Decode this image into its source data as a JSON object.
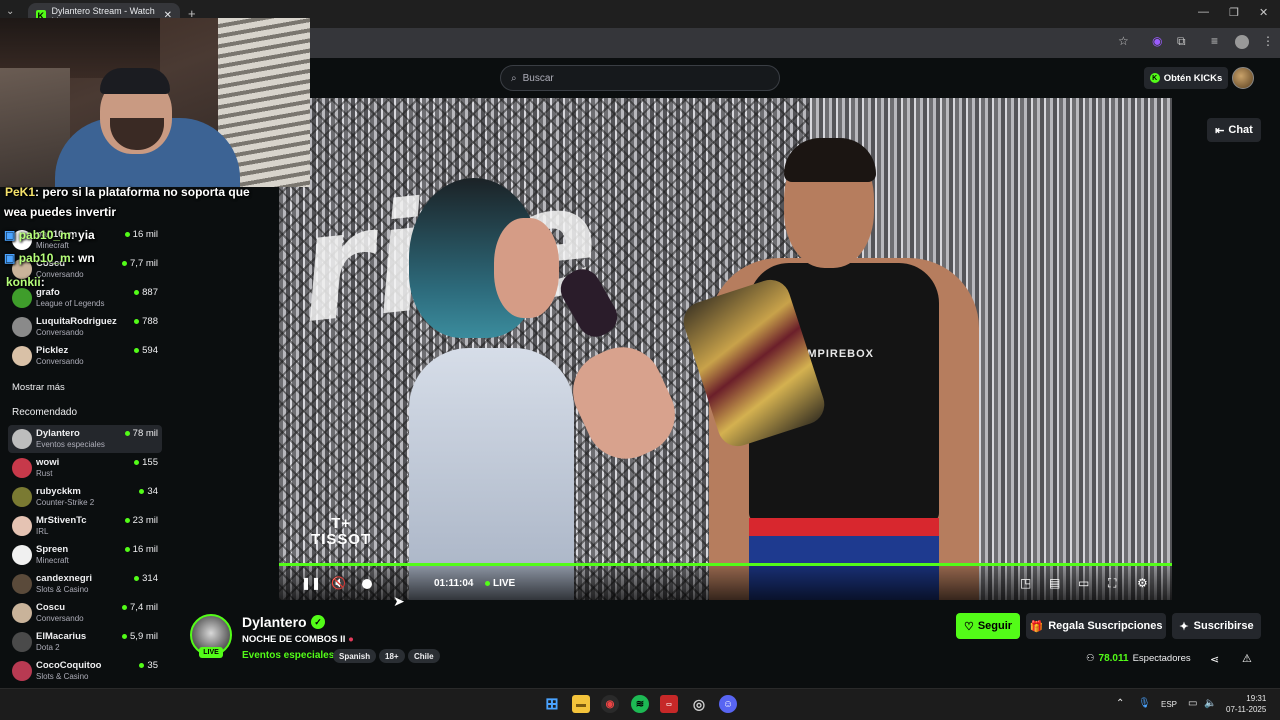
{
  "browser": {
    "tab_title": "Dylantero Stream - Watch Live",
    "tab_close": "✕",
    "new_tab": "+",
    "window_controls": [
      "—",
      "❐",
      "✕"
    ]
  },
  "header": {
    "search_placeholder": "Buscar",
    "kicks_button": "Obtén KICKs"
  },
  "sidebar": {
    "following": [
      {
        "name": "pab10_m",
        "category": "Minecraft",
        "viewers": "16 mil"
      },
      {
        "name": "Coscu",
        "category": "Conversando",
        "viewers": "7,7 mil"
      },
      {
        "name": "grafo",
        "category": "League of Legends",
        "viewers": "887"
      },
      {
        "name": "LuquitaRodriguez",
        "category": "Conversando",
        "viewers": "788"
      },
      {
        "name": "Picklez",
        "category": "Conversando",
        "viewers": "594"
      }
    ],
    "show_more": "Mostrar más",
    "recommended_label": "Recomendado",
    "recommended": [
      {
        "name": "Dylantero",
        "category": "Eventos especiales",
        "viewers": "78 mil"
      },
      {
        "name": "wowi",
        "category": "Rust",
        "viewers": "155"
      },
      {
        "name": "rubyckkm",
        "category": "Counter-Strike 2",
        "viewers": "34"
      },
      {
        "name": "MrStivenTc",
        "category": "IRL",
        "viewers": "23 mil"
      },
      {
        "name": "Spreen",
        "category": "Minecraft",
        "viewers": "16 mil"
      },
      {
        "name": "candexnegri",
        "category": "Slots & Casino",
        "viewers": "314"
      },
      {
        "name": "Coscu",
        "category": "Conversando",
        "viewers": "7,4 mil"
      },
      {
        "name": "ElMacarius",
        "category": "Dota 2",
        "viewers": "5,9 mil"
      },
      {
        "name": "CocoCoquitoo",
        "category": "Slots & Casino",
        "viewers": "35"
      }
    ]
  },
  "chat_overlay": [
    {
      "user": "PeK1",
      "text": ": pero si la plataforma no soporta que"
    },
    {
      "user": "",
      "text": "wea puedes invertir"
    },
    {
      "user": "pab10_m",
      "text": ": yia"
    },
    {
      "user": "pab10_m",
      "text": ": wn"
    },
    {
      "user": "konkii",
      "text": ":"
    }
  ],
  "video": {
    "overlay_logo_top": "T+",
    "overlay_logo": "TISSOT",
    "tank_text": "EMPIREBOX",
    "time": "01:11:04",
    "live": "LIVE"
  },
  "chat_button": "Chat",
  "channel": {
    "name": "Dylantero",
    "live_badge": "LIVE",
    "title": "NOCHE DE COMBOS II",
    "category": "Eventos especiales",
    "tags": [
      "Spanish",
      "18+",
      "Chile"
    ],
    "follow": "Seguir",
    "gift": "Regala Suscripciones",
    "subscribe": "Suscribirse",
    "viewers_num": "78.011",
    "viewers_label": "Espectadores"
  },
  "taskbar": {
    "lang": "ESP",
    "time": "19:31",
    "date": "07-11-2025"
  },
  "colors": {
    "accent": "#53fc18",
    "bg": "#0b0e0f",
    "panel": "#24272c"
  }
}
